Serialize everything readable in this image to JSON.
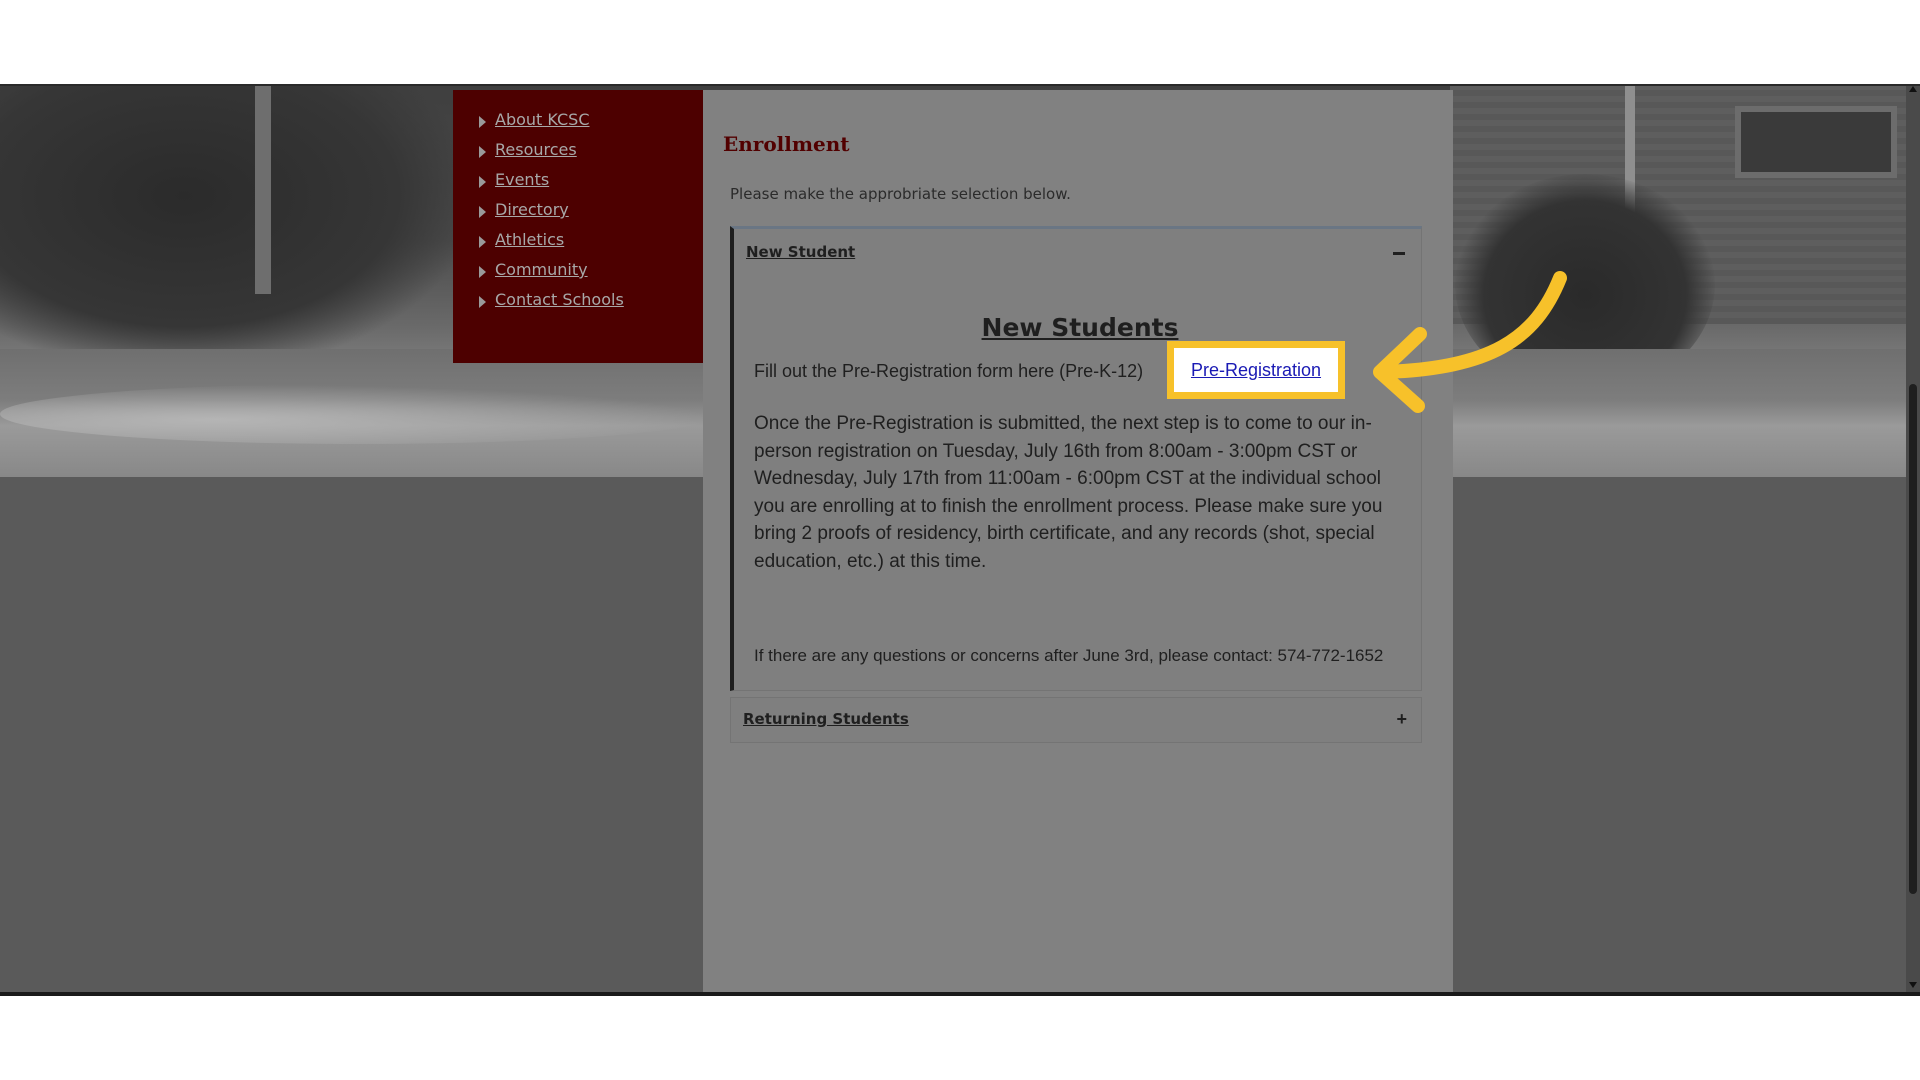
{
  "sidebar": {
    "items": [
      {
        "label": "About KCSC"
      },
      {
        "label": "Resources"
      },
      {
        "label": "Events"
      },
      {
        "label": "Directory"
      },
      {
        "label": "Athletics"
      },
      {
        "label": "Community"
      },
      {
        "label": "Contact Schools"
      }
    ]
  },
  "main": {
    "title": "Enrollment",
    "intro": "Please make the approbriate selection below.",
    "accordion": [
      {
        "label": "New Student",
        "expanded": true,
        "toggle_icon": "minus-icon",
        "heading": "New Students",
        "fill_line": "Fill out the Pre-Registration form here (Pre-K-12)",
        "link_label": "Pre-Registration",
        "paragraph1": "Once the Pre-Registration is submitted, the next step is to come to our in-person registration on Tuesday, July 16th from 8:00am - 3:00pm CST or Wednesday, July 17th from 11:00am - 6:00pm CST at the individual school you are enrolling at to finish the enrollment process. Please make sure you bring 2 proofs of residency, birth certificate, and any records (shot, special education, etc.) at this time.",
        "paragraph2": "If there are any questions or concerns after June 3rd, please contact: 574-772-1652"
      },
      {
        "label": "Returning Students",
        "expanded": false,
        "toggle_icon": "plus-icon"
      }
    ]
  },
  "colors": {
    "sidebar_bg": "#4d0000",
    "title": "#520000",
    "highlight": "#f7c12a",
    "link": "#1a1ab4"
  }
}
